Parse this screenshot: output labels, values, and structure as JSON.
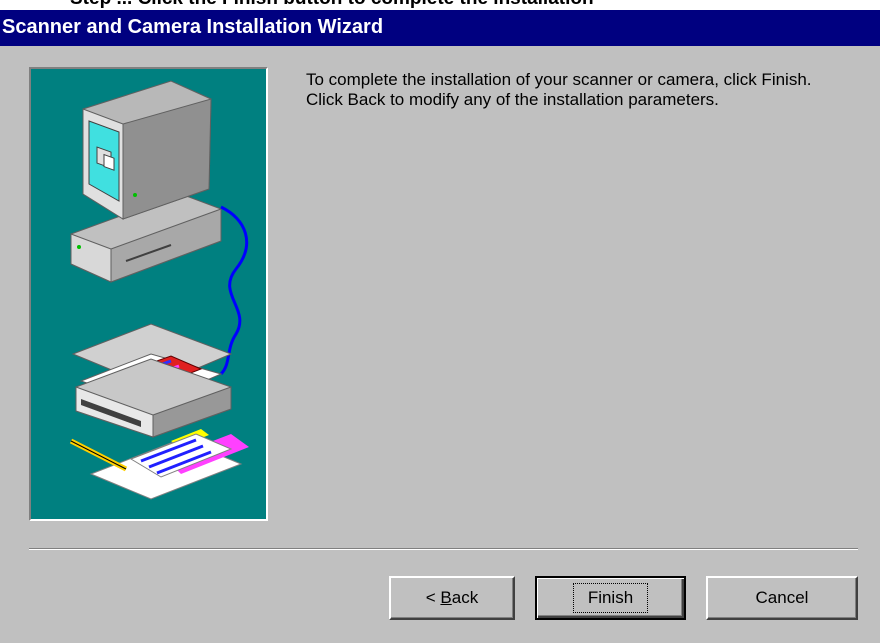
{
  "cut_caption": "Step ... Click the Finish button to complete the installation",
  "window": {
    "title": "Scanner and Camera Installation Wizard"
  },
  "message": "To complete the installation of your scanner or camera, click Finish.  Click Back to modify any of the installation parameters.",
  "buttons": {
    "back_prefix": "< ",
    "back_mnemonic": "B",
    "back_rest": "ack",
    "finish": "Finish",
    "cancel": "Cancel"
  },
  "colors": {
    "titlebar": "#000080",
    "panel": "#008080",
    "dialog": "#c0c0c0"
  },
  "icons": [
    "computer-icon",
    "scanner-icon",
    "documents-icon"
  ]
}
